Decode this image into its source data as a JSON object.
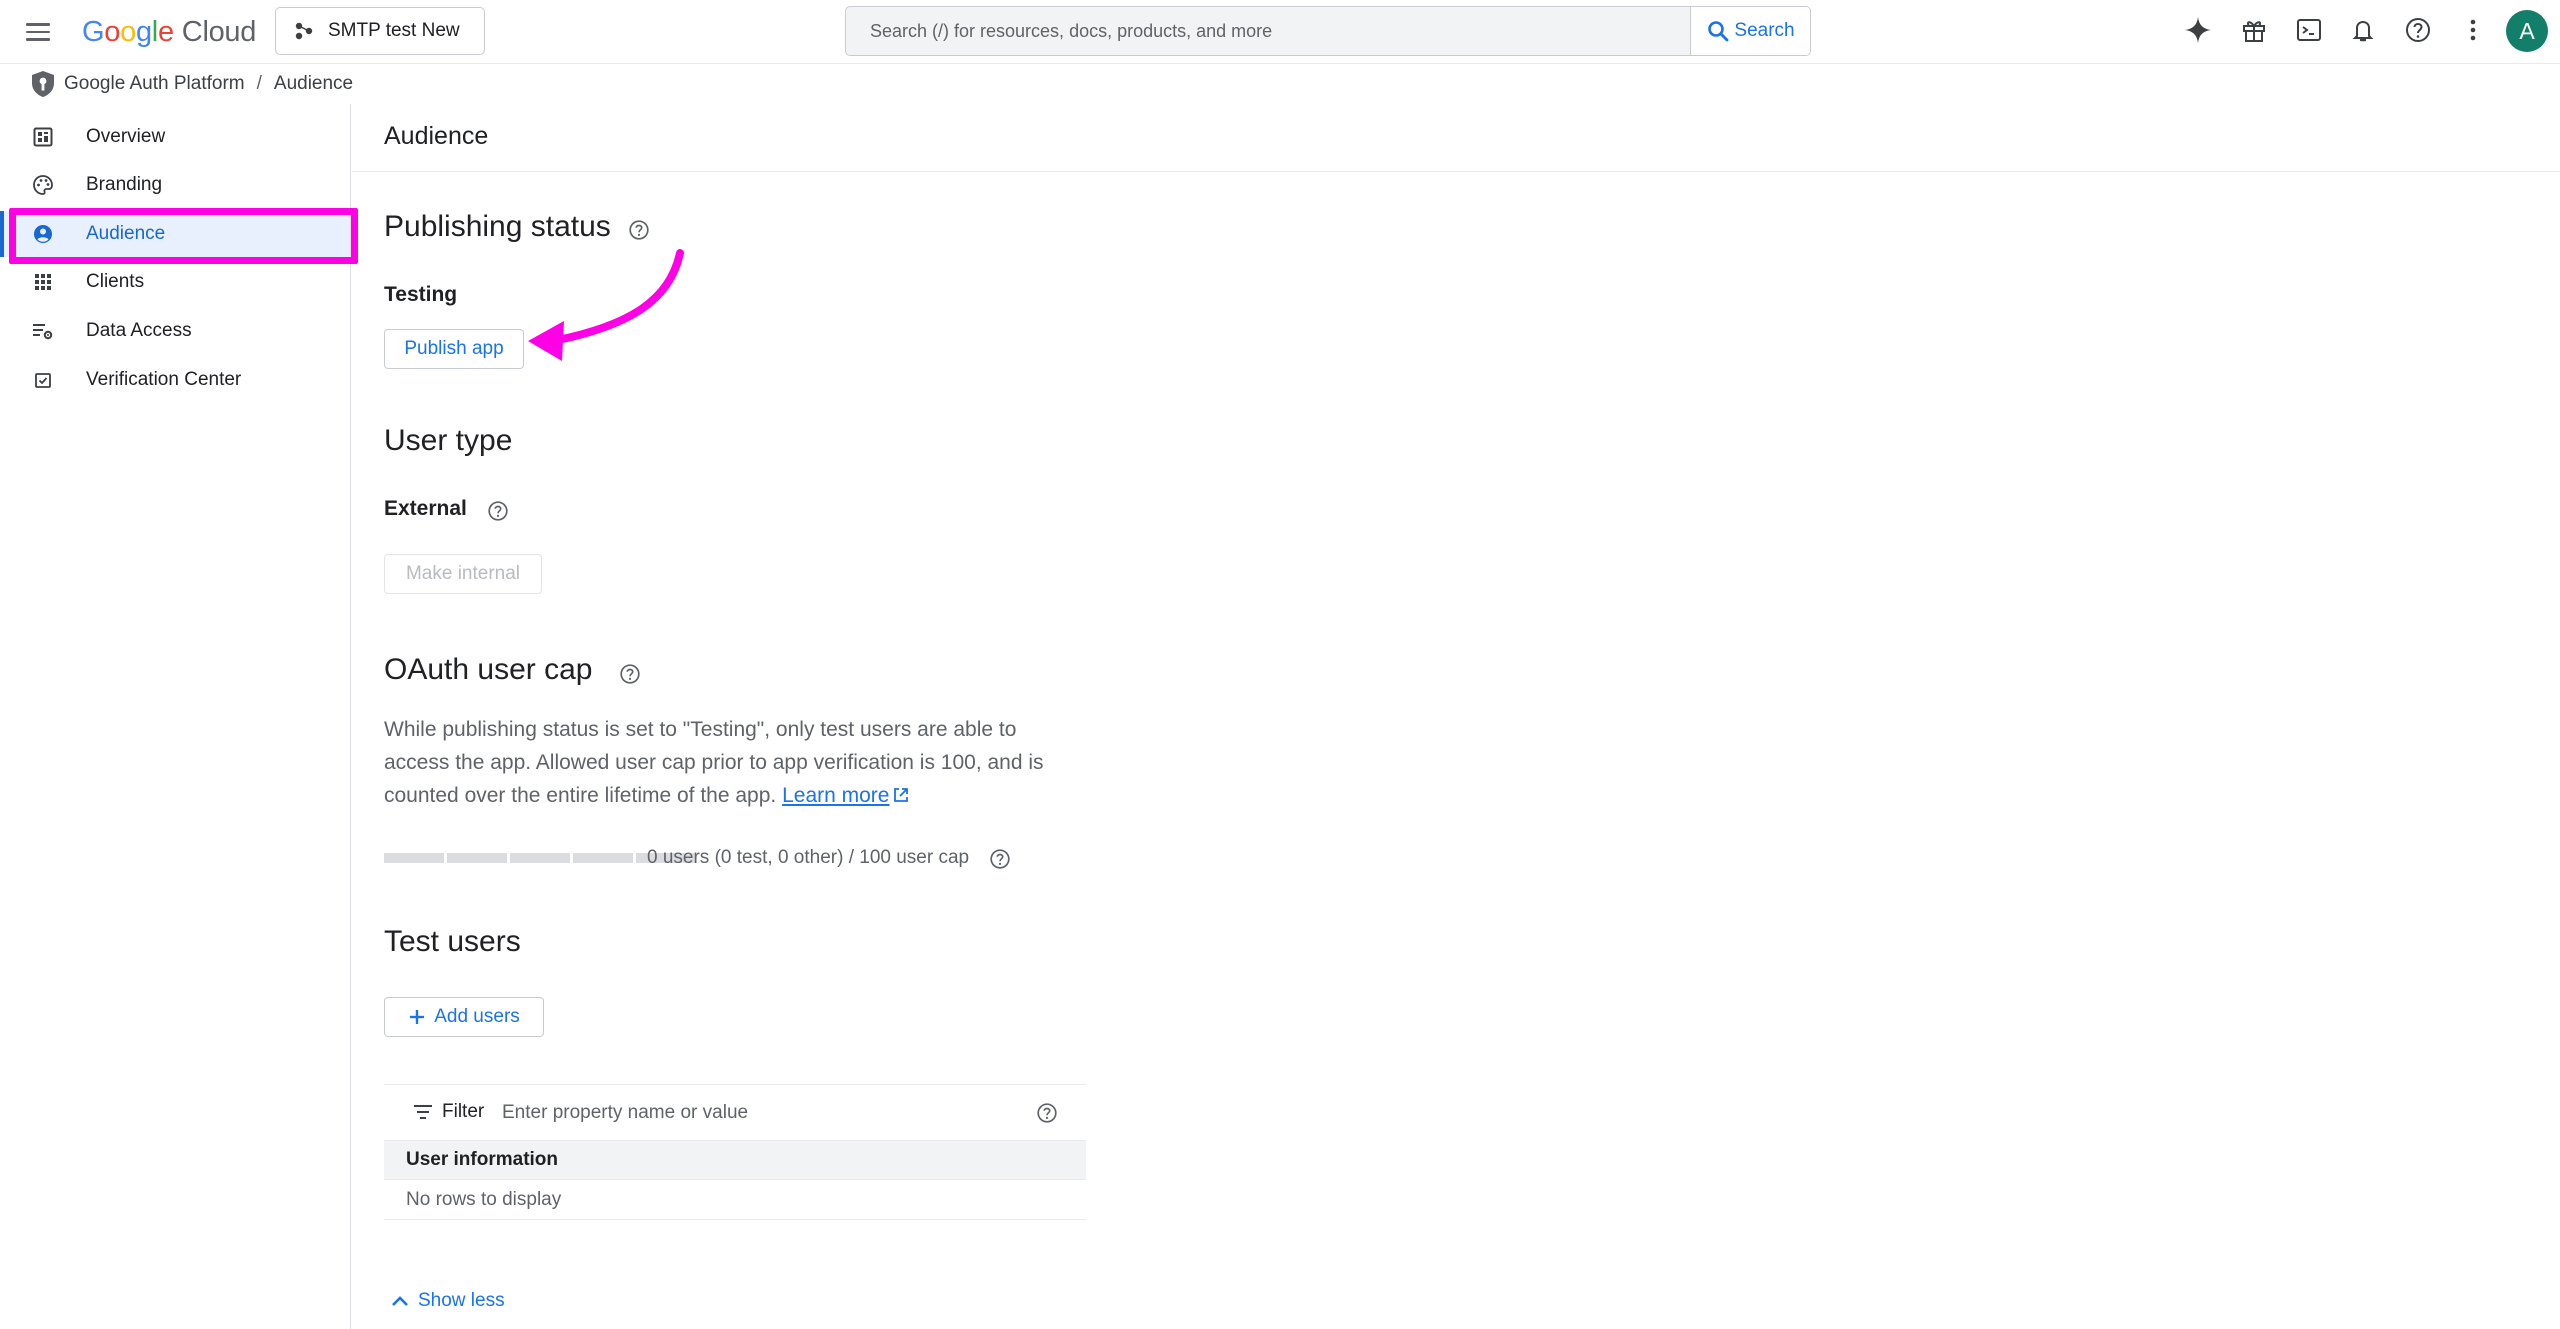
{
  "topbar": {
    "logo_google_letters": [
      "G",
      "o",
      "o",
      "g",
      "l",
      "e"
    ],
    "logo_cloud": "Cloud",
    "project_name": "SMTP test New",
    "search_placeholder": "Search (/) for resources, docs, products, and more",
    "search_button": "Search",
    "avatar_letter": "A",
    "icons": [
      "sparkle-icon",
      "gift-icon",
      "terminal-icon",
      "bell-icon",
      "help-icon",
      "more-vert-icon"
    ]
  },
  "breadcrumb": {
    "root": "Google Auth Platform",
    "separator": "/",
    "current": "Audience"
  },
  "sidebar": {
    "items": [
      {
        "label": "Overview",
        "icon": "dashboard-icon"
      },
      {
        "label": "Branding",
        "icon": "palette-icon"
      },
      {
        "label": "Audience",
        "icon": "account-circle-icon",
        "active": true
      },
      {
        "label": "Clients",
        "icon": "apps-grid-icon"
      },
      {
        "label": "Data Access",
        "icon": "data-settings-icon"
      },
      {
        "label": "Verification Center",
        "icon": "verified-check-icon"
      }
    ]
  },
  "page": {
    "title": "Audience"
  },
  "publishing": {
    "heading": "Publishing status",
    "status": "Testing",
    "publish_button": "Publish app"
  },
  "user_type": {
    "heading": "User type",
    "value": "External",
    "make_internal_button": "Make internal"
  },
  "cap": {
    "heading": "OAuth user cap",
    "description": "While publishing status is set to \"Testing\", only test users are able to access the app. Allowed user cap prior to app verification is 100, and is counted over the entire lifetime of the app.",
    "learn_more": "Learn more",
    "usage_text": "0 users (0 test, 0 other) / 100 user cap",
    "usage_fraction": 0
  },
  "test_users": {
    "heading": "Test users",
    "add_button": "Add users",
    "filter_label": "Filter",
    "filter_placeholder": "Enter property name or value",
    "column_header": "User information",
    "empty_text": "No rows to display",
    "show_less": "Show less"
  },
  "colors": {
    "accent": "#1a73e8",
    "annotation": "#ff00e6",
    "active_bg": "#e8f0fe",
    "avatar_bg": "#137f6a"
  }
}
